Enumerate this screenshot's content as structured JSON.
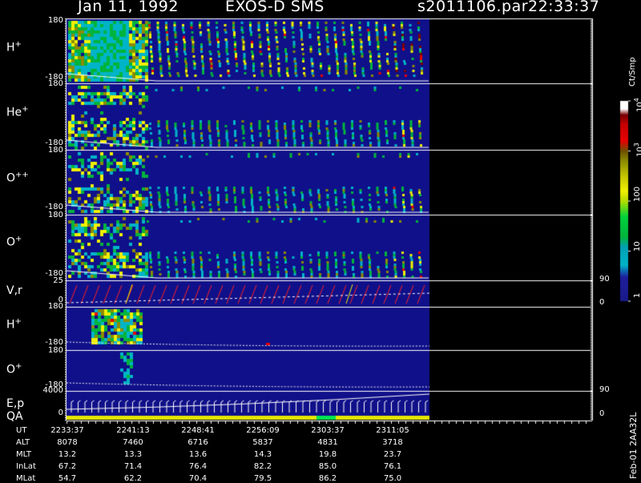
{
  "header": {
    "date": "Jan 11, 1992",
    "instrument": "EXOS-D SMS",
    "file": "s2011106.par",
    "time": "22:33:37"
  },
  "side_label": "Feb-01 2AA32L",
  "colorbar": {
    "unit": "Ct/Smp",
    "ticks": [
      "1",
      "10",
      "100",
      "10^3",
      "10^4"
    ],
    "ticks_display": [
      {
        "base": "1",
        "exp": ""
      },
      {
        "base": "10",
        "exp": ""
      },
      {
        "base": "100",
        "exp": ""
      },
      {
        "base": "10",
        "exp": "3"
      },
      {
        "base": "10",
        "exp": "4"
      }
    ]
  },
  "panels": [
    {
      "id": "hplus1",
      "species": "H",
      "charge": "+",
      "ytop": "180",
      "ybot": "-180"
    },
    {
      "id": "heplus",
      "species": "He",
      "charge": "+",
      "ytop": "180",
      "ybot": "-180"
    },
    {
      "id": "oplusplus",
      "species": "O",
      "charge": "++",
      "ytop": "180",
      "ybot": "-180"
    },
    {
      "id": "oplus1",
      "species": "O",
      "charge": "+",
      "ytop": "180",
      "ybot": "-180"
    },
    {
      "id": "vr",
      "species": "V,r",
      "charge": "",
      "ytop": "25",
      "ybot": "0",
      "rtop": "90",
      "rbot": "0"
    },
    {
      "id": "hplus2",
      "species": "H",
      "charge": "+",
      "ytop": "180",
      "ybot": "-180"
    },
    {
      "id": "oplus2",
      "species": "O",
      "charge": "+",
      "ytop": "180",
      "ybot": "-180"
    },
    {
      "id": "ep",
      "species": "E,p",
      "charge": "",
      "ytop": "4000",
      "ybot": "0",
      "rtop": "90",
      "rbot": "0",
      "extra": "QA"
    }
  ],
  "chart_data": {
    "type": "heatmap",
    "title": "Jan 11, 1992   EXOS-D SMS",
    "time_axis": [
      "2233:37",
      "2241:13",
      "2248:41",
      "2256:09",
      "2303:37",
      "2311:05"
    ],
    "ephemeris": [
      {
        "label": "UT",
        "values": [
          "2233:37",
          "2241:13",
          "2248:41",
          "2256:09",
          "2303:37",
          "2311:05"
        ]
      },
      {
        "label": "ALT",
        "values": [
          "8078",
          "7460",
          "6716",
          "5837",
          "4831",
          "3718"
        ]
      },
      {
        "label": "MLT",
        "values": [
          "13.2",
          "13.3",
          "13.6",
          "14.3",
          "19.8",
          "23.7"
        ]
      },
      {
        "label": "InLat",
        "values": [
          "67.2",
          "71.4",
          "76.4",
          "82.2",
          "85.0",
          "76.1"
        ]
      },
      {
        "label": "MLat",
        "values": [
          "54.7",
          "62.2",
          "70.4",
          "79.5",
          "86.2",
          "75.0"
        ]
      }
    ],
    "colorscale": {
      "min": 1,
      "max": 10000,
      "log": true,
      "unit": "Ct/Smp"
    },
    "colors": {
      "background": "#000000",
      "panel_bg": "#10108a",
      "panel_bg2": "#0c1ea0",
      "cyan": "#00b4c8",
      "green": "#00b43c",
      "yellow": "#f0f000",
      "olive": "#8c8c00",
      "red": "#e60000",
      "darkred": "#7a0000",
      "white": "#ffffff",
      "trace_red": "#ff2020",
      "qa_yellow": "#e6e600",
      "qa_green": "#00e650"
    }
  }
}
